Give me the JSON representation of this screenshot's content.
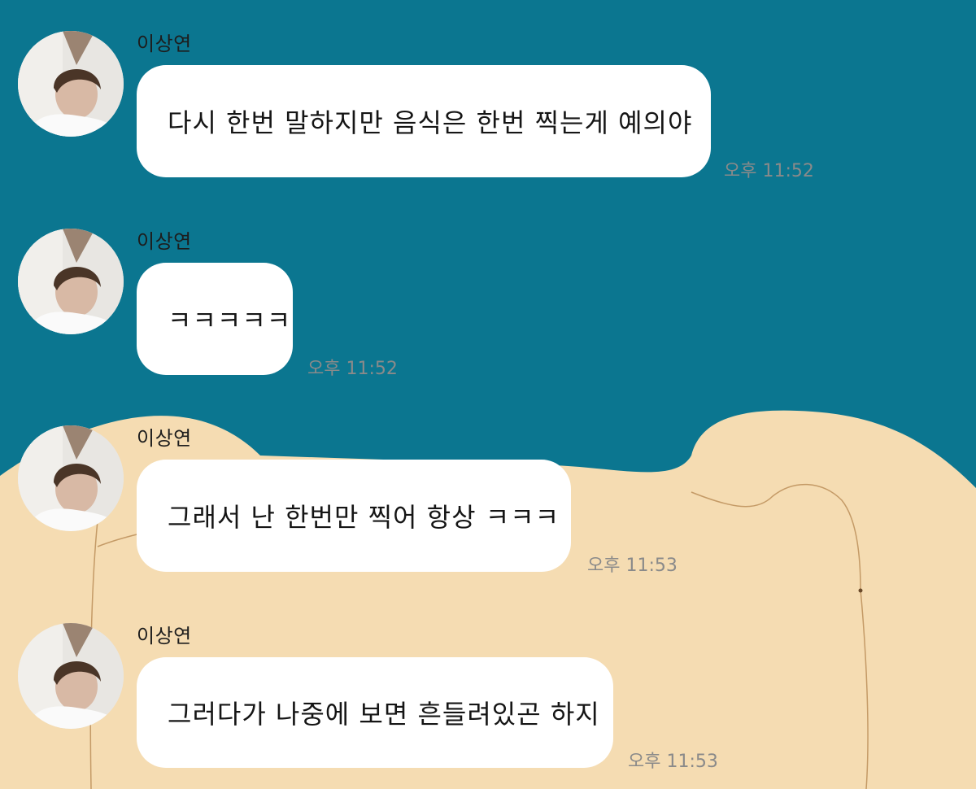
{
  "colors": {
    "background_top": "#0b7690",
    "background_bottom": "#f5dcb2",
    "bubble": "#ffffff",
    "timestamp": "#8a8a8a"
  },
  "messages": [
    {
      "sender": "이상연",
      "text": "다시 한번 말하지만 음식은 한번 찍는게 예의야",
      "time": "오후 11:52",
      "avatar_icon": "profile-photo-icon"
    },
    {
      "sender": "이상연",
      "text": "ㅋㅋㅋㅋㅋ",
      "time": "오후 11:52",
      "avatar_icon": "profile-photo-icon"
    },
    {
      "sender": "이상연",
      "text": "그래서 난 한번만 찍어 항상 ㅋㅋㅋ",
      "time": "오후 11:53",
      "avatar_icon": "profile-photo-icon"
    },
    {
      "sender": "이상연",
      "text": "그러다가 나중에 보면 흔들려있곤 하지",
      "time": "오후 11:53",
      "avatar_icon": "profile-photo-icon"
    }
  ]
}
